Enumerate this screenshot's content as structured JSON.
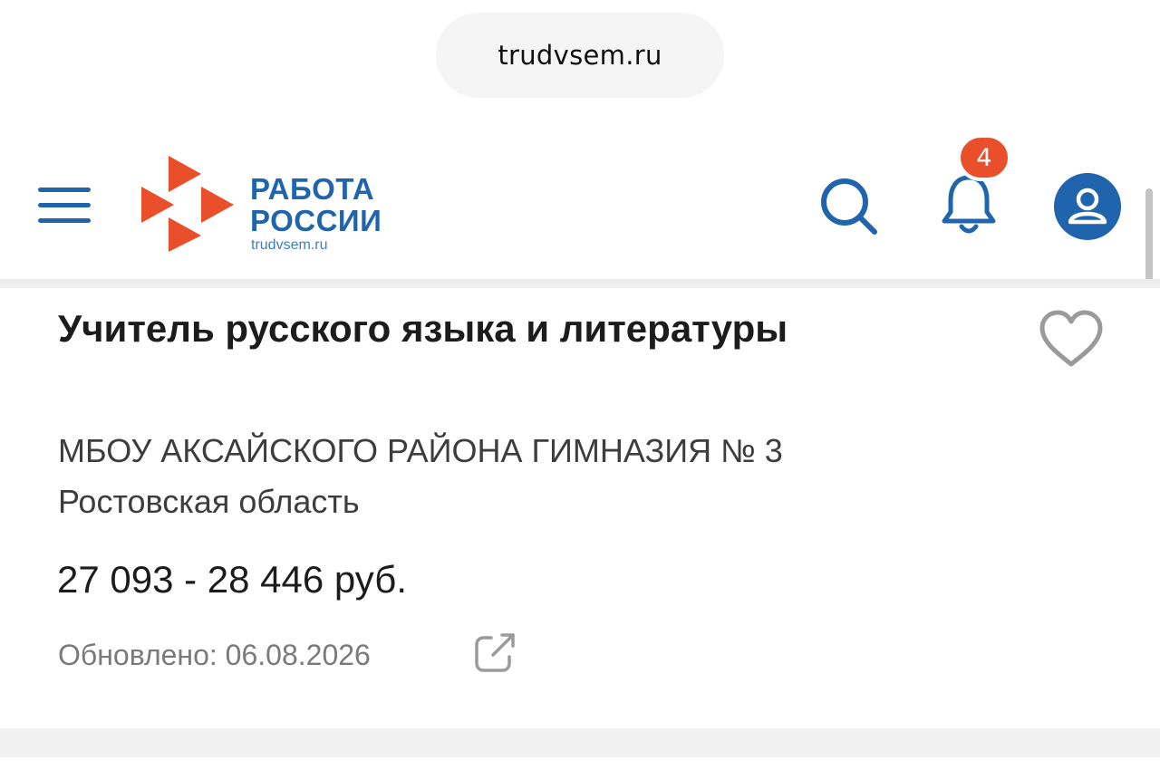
{
  "browser": {
    "url": "trudvsem.ru"
  },
  "header": {
    "logo_title_line1": "РАБОТА",
    "logo_title_line2": "РОССИИ",
    "logo_subtitle": "trudvsem.ru",
    "notification_count": "4",
    "icons": {
      "menu": "hamburger-menu-icon",
      "search": "search-icon",
      "notifications": "bell-icon",
      "profile": "user-icon"
    }
  },
  "vacancy": {
    "title": "Учитель русского языка и литературы",
    "employer": "МБОУ АКСАЙСКОГО РАЙОНА ГИМНАЗИЯ № 3",
    "region": "Ростовская область",
    "salary": "27 093 - 28 446 руб.",
    "updated": "Обновлено: 06.08.2026",
    "icons": {
      "favorite": "heart-icon",
      "share": "external-link-icon"
    }
  },
  "colors": {
    "brand_blue": "#1f64ad",
    "brand_red": "#e84f2a",
    "text_dark": "#1c1c1c",
    "text_muted": "#7a7a7a"
  }
}
